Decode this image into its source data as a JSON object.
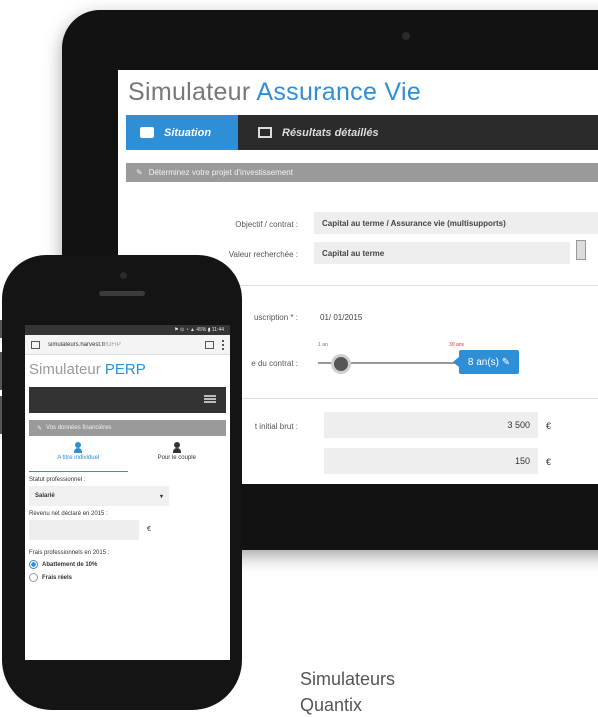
{
  "tablet": {
    "title_plain": "Simulateur ",
    "title_accent": "Assurance Vie",
    "tabs": [
      {
        "label": "Situation",
        "icon": "folder-icon"
      },
      {
        "label": "Résultats détaillés",
        "icon": "chart-icon"
      }
    ],
    "banner": "Déterminez votre projet d'investissement",
    "rows": {
      "objectif_label": "Objectif / contrat :",
      "objectif_value": "Capital au terme / Assurance vie (multisupports)",
      "valeur_label": "Valeur recherchée :",
      "valeur_value": "Capital au terme",
      "souscription_label": "uscription * :",
      "souscription_value": "01/ 01/2015",
      "duree_label": "e du contrat :",
      "slider_min": "1 an",
      "slider_max": "30 ans",
      "slider_value": "8 an(s) ✎",
      "versement_label": "t initial brut :",
      "versement_value": "3 500",
      "versement_currency": "€",
      "periodique_value": "150",
      "periodique_currency": "€"
    }
  },
  "phone": {
    "status": "⚑ ⊙ ◔ ▲ 45% ▮ 11:44",
    "url_main": "simulateurs.harvest.fr",
    "url_fade": "/DFIP",
    "title_plain": "Simulateur ",
    "title_accent": "PERP",
    "banner": "Vos données financières",
    "options": [
      {
        "label": "A titre individuel",
        "active": true
      },
      {
        "label": "Pour le couple",
        "active": false
      }
    ],
    "statut_label": "Statut professionnel :",
    "statut_value": "Salarié",
    "revenu_label": "Revenu net déclaré en 2015 :",
    "revenu_currency": "€",
    "frais_label": "Frais professionnels en 2015 :",
    "radio_options": [
      {
        "label": "Abattement de 10%",
        "selected": true
      },
      {
        "label": "Frais réels",
        "selected": false
      }
    ]
  },
  "tagline": {
    "line1": "Simulateurs",
    "line2": "Quantix"
  },
  "colors": {
    "accent": "#2e8fd6",
    "dark_bar": "#2b2b2b",
    "banner_gray": "#9a9a9a"
  }
}
